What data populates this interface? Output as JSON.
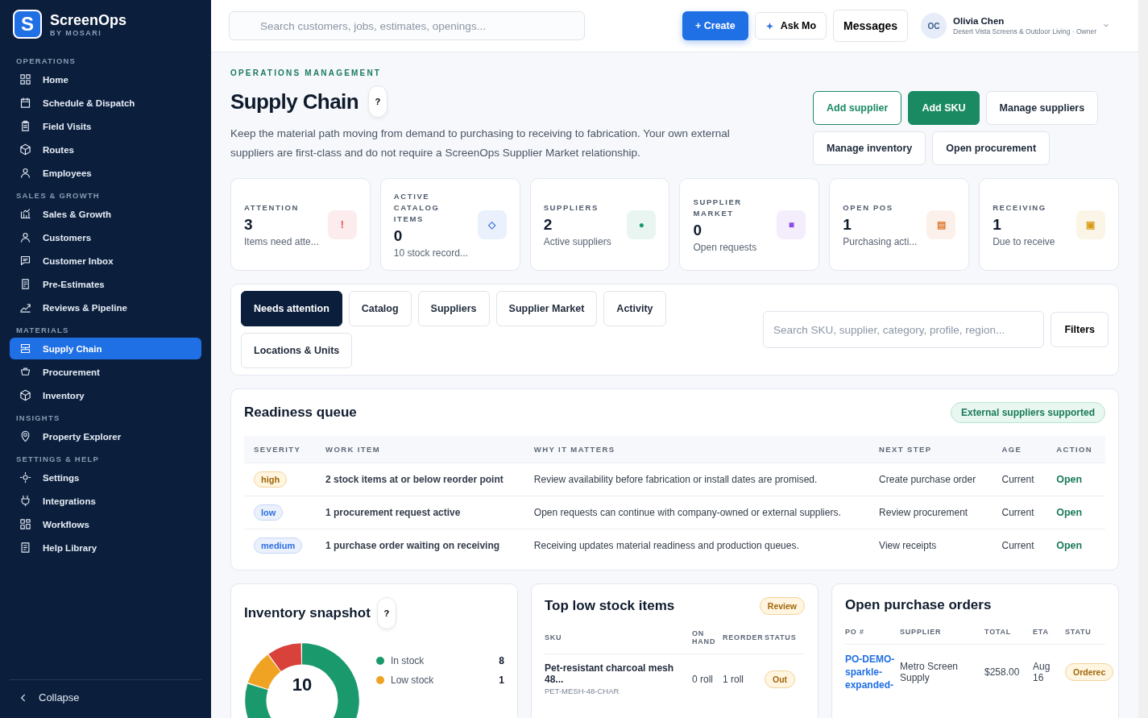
{
  "brand": {
    "name": "ScreenOps",
    "sub": "BY MOSARI",
    "logo_letter": "S"
  },
  "sidebar": {
    "sections": [
      {
        "title": "OPERATIONS",
        "items": [
          {
            "label": "Home",
            "selected": false
          },
          {
            "label": "Schedule & Dispatch",
            "selected": false
          },
          {
            "label": "Field Visits",
            "selected": false
          },
          {
            "label": "Routes",
            "selected": false
          },
          {
            "label": "Employees",
            "selected": false
          }
        ]
      },
      {
        "title": "SALES & GROWTH",
        "items": [
          {
            "label": "Sales & Growth",
            "selected": false
          },
          {
            "label": "Customers",
            "selected": false
          },
          {
            "label": "Customer Inbox",
            "selected": false
          },
          {
            "label": "Pre-Estimates",
            "selected": false
          },
          {
            "label": "Reviews & Pipeline",
            "selected": false
          }
        ]
      },
      {
        "title": "MATERIALS",
        "items": [
          {
            "label": "Supply Chain",
            "selected": true
          },
          {
            "label": "Procurement",
            "selected": false
          },
          {
            "label": "Inventory",
            "selected": false
          }
        ]
      },
      {
        "title": "INSIGHTS",
        "items": [
          {
            "label": "Property Explorer",
            "selected": false
          }
        ]
      },
      {
        "title": "SETTINGS & HELP",
        "items": [
          {
            "label": "Settings",
            "selected": false
          },
          {
            "label": "Integrations",
            "selected": false
          },
          {
            "label": "Workflows",
            "selected": false
          },
          {
            "label": "Help Library",
            "selected": false
          }
        ]
      }
    ],
    "collapse": "Collapse"
  },
  "topbar": {
    "search": {
      "placeholder": "Search customers, jobs, estimates, openings..."
    },
    "create": "+ Create",
    "ask": "Ask Mo",
    "messages": "Messages",
    "user": {
      "initials": "OC",
      "name": "Olivia Chen",
      "org": "Desert Vista Screens & Outdoor Living · Owner"
    }
  },
  "header": {
    "eyebrow": "OPERATIONS MANAGEMENT",
    "title": "Supply Chain",
    "help": "?",
    "description": "Keep the material path moving from demand to purchasing to receiving to fabrication. Your own external suppliers are first-class and do not require a ScreenOps Supplier Market relationship.",
    "actions": [
      {
        "label": "Add supplier",
        "kind": "outline"
      },
      {
        "label": "Add SKU",
        "kind": "primary"
      },
      {
        "label": "Manage suppliers",
        "kind": "plain"
      },
      {
        "label": "Manage inventory",
        "kind": "plain"
      },
      {
        "label": "Open procurement",
        "kind": "plain"
      }
    ]
  },
  "stats": [
    {
      "label": "ATTENTION",
      "value": "3",
      "sub": "Items need atte...",
      "color": "#e5484d",
      "glyph": "!"
    },
    {
      "label": "ACTIVE CATALOG ITEMS",
      "value": "0",
      "sub": "10 stock record...",
      "color": "#2f6fe0",
      "glyph": "◇"
    },
    {
      "label": "SUPPLIERS",
      "value": "2",
      "sub": "Active suppliers",
      "color": "#1a9a6c",
      "glyph": "●"
    },
    {
      "label": "SUPPLIER MARKET",
      "value": "0",
      "sub": "Open requests",
      "color": "#8b4ce6",
      "glyph": "■"
    },
    {
      "label": "OPEN POS",
      "value": "1",
      "sub": "Purchasing acti...",
      "color": "#e07a2f",
      "glyph": "▤"
    },
    {
      "label": "RECEIVING",
      "value": "1",
      "sub": "Due to receive",
      "color": "#d99a14",
      "glyph": "▣"
    }
  ],
  "tabs": [
    {
      "label": "Needs attention",
      "selected": true
    },
    {
      "label": "Catalog",
      "selected": false
    },
    {
      "label": "Suppliers",
      "selected": false
    },
    {
      "label": "Supplier Market",
      "selected": false
    },
    {
      "label": "Activity",
      "selected": false
    },
    {
      "label": "Locations & Units",
      "selected": false
    }
  ],
  "filter": {
    "placeholder": "Search SKU, supplier, category, profile, region...",
    "button": "Filters"
  },
  "queue": {
    "title": "Readiness queue",
    "badge": "External suppliers supported",
    "columns": [
      "SEVERITY",
      "WORK ITEM",
      "WHY IT MATTERS",
      "NEXT STEP",
      "AGE",
      "ACTION"
    ],
    "rows": [
      {
        "severity": "high",
        "kind": "warning",
        "item": "2 stock items at or below reorder point",
        "why": "Review availability before fabrication or install dates are promised.",
        "next": "Create purchase order",
        "age": "Current",
        "action": "Open"
      },
      {
        "severity": "low",
        "kind": "info",
        "item": "1 procurement request active",
        "why": "Open requests can continue with company-owned or external suppliers.",
        "next": "Review procurement",
        "age": "Current",
        "action": "Open"
      },
      {
        "severity": "medium",
        "kind": "info",
        "item": "1 purchase order waiting on receiving",
        "why": "Receiving updates material readiness and production queues.",
        "next": "View receipts",
        "age": "Current",
        "action": "Open"
      }
    ]
  },
  "snapshot": {
    "title": "Inventory snapshot",
    "help": "?",
    "total": "10",
    "legend": [
      {
        "label": "In stock",
        "value": "8",
        "color": "#1a9a6c"
      },
      {
        "label": "Low stock",
        "value": "1",
        "color": "#f0a323"
      }
    ]
  },
  "low_stock": {
    "title": "Top low stock items",
    "badge": "Review",
    "columns": [
      "SKU",
      "ON HAND",
      "REORDER",
      "STATUS"
    ],
    "rows": [
      {
        "name": "Pet-resistant charcoal mesh 48...",
        "code": "PET-MESH-48-CHAR",
        "on_hand": "0 roll",
        "reorder": "1 roll",
        "status": "Out"
      }
    ]
  },
  "purchase_orders": {
    "title": "Open purchase orders",
    "columns": [
      "PO #",
      "SUPPLIER",
      "TOTAL",
      "ETA",
      "STATU"
    ],
    "rows": [
      {
        "po": "PO-DEMO-sparkle-expanded-",
        "supplier": "Metro Screen Supply",
        "total": "$258.00",
        "eta": "Aug 16",
        "status": "Orderec"
      }
    ]
  }
}
